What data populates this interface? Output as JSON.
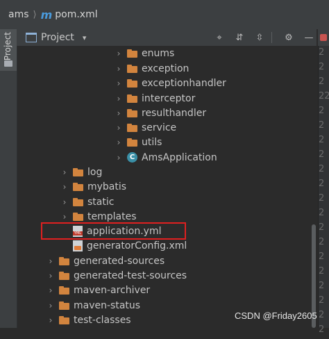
{
  "breadcrumb": {
    "root": "ams",
    "separator": "⟩",
    "module_letter": "m",
    "file": "pom.xml"
  },
  "side_tab": {
    "label": "Project"
  },
  "toolbar": {
    "title": "Project",
    "caret": "▾",
    "locate_icon": "⌖",
    "expand_icon": "⇵",
    "collapse_icon": "⇳",
    "settings_icon": "⚙",
    "hide_icon": "—"
  },
  "tree": {
    "enums": "enums",
    "exception": "exception",
    "exceptionhandler": "exceptionhandler",
    "interceptor": "interceptor",
    "resulthandler": "resulthandler",
    "service": "service",
    "utils": "utils",
    "ams_application": "AmsApplication",
    "log": "log",
    "mybatis": "mybatis",
    "static": "static",
    "templates": "templates",
    "application_yml": "application.yml",
    "generator_config": "generatorConfig.xml",
    "generated_sources": "generated-sources",
    "generated_test_sources": "generated-test-sources",
    "maven_archiver": "maven-archiver",
    "maven_status": "maven-status",
    "test_classes": "test-classes"
  },
  "right_gutter": [
    "2",
    "2",
    "2",
    "22",
    "2",
    "2",
    "2",
    "2",
    "2",
    "2",
    "2",
    "2",
    "2",
    "2",
    "2",
    "2",
    "2",
    "2",
    "2",
    "2"
  ],
  "watermark": "CSDN @Friday2605",
  "colors": {
    "folder": "#d2843e",
    "highlight": "#e02020",
    "background": "#2b2b2b"
  }
}
